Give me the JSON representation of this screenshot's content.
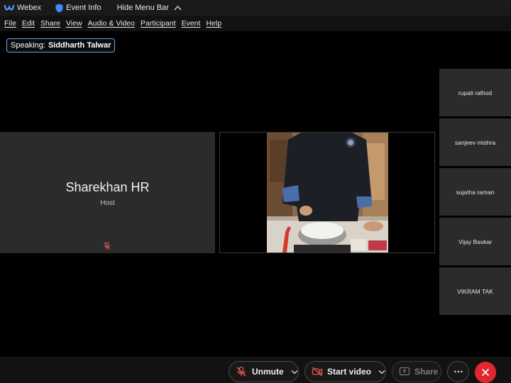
{
  "titlebar": {
    "app_name": "Webex",
    "event_info": "Event Info",
    "hide_menu": "Hide Menu Bar"
  },
  "menu": [
    "File",
    "Edit",
    "Share",
    "View",
    "Audio & Video",
    "Participant",
    "Event",
    "Help"
  ],
  "speaking": {
    "label": "Speaking:",
    "name": "Siddharth Talwar"
  },
  "host_tile": {
    "name": "Sharekhan HR",
    "role": "Host"
  },
  "participants": [
    "rupali rathod",
    "sanjeev mishra",
    "sujatha raman",
    "Vijay Bavkar",
    "VIKRAM TAK"
  ],
  "controls": {
    "unmute": "Unmute",
    "start_video": "Start video",
    "share": "Share"
  },
  "colors": {
    "accent_border": "#6aa6e8",
    "leave_red": "#e0292e",
    "tile_bg": "#2b2b2b"
  }
}
